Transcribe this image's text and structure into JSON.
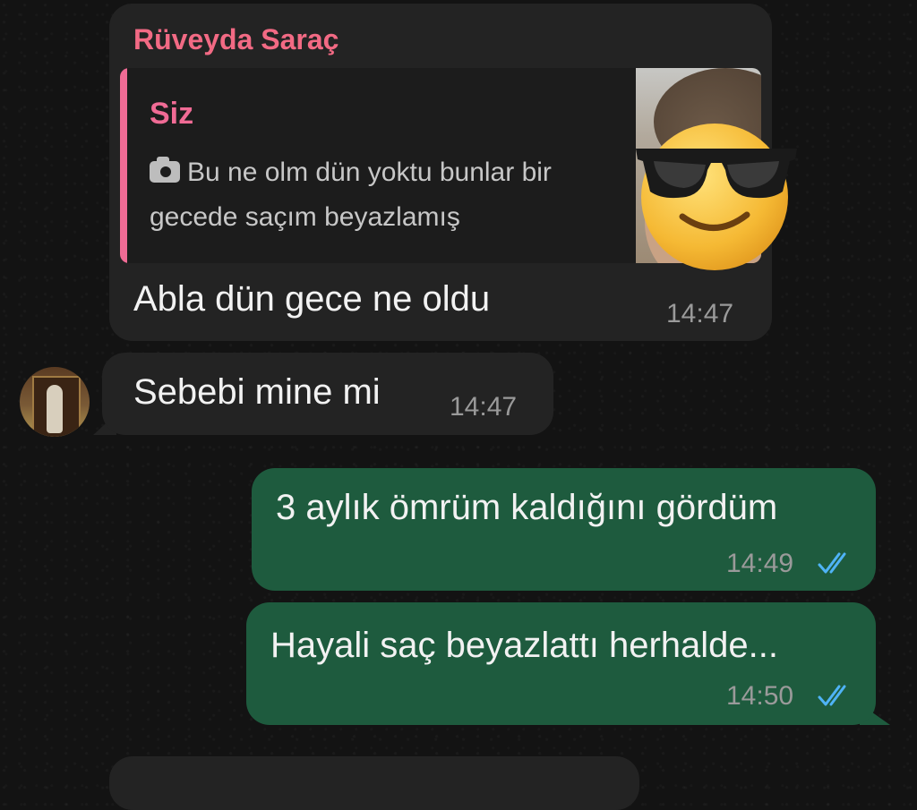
{
  "colors": {
    "background": "#131313",
    "incoming_bubble": "#232323",
    "outgoing_bubble": "#1e5b3e",
    "sender_name": "#f26a84",
    "quote_accent": "#f06b95",
    "read_ticks": "#4fb3f6",
    "timestamp": "#9a9a9a"
  },
  "messages": [
    {
      "sender": "Rüveyda Saraç",
      "reply": {
        "author": "Siz",
        "icon": "camera-icon",
        "text": "Bu ne olm dün yoktu bunlar bir gecede saçım beyazlamış",
        "thumbnail": "photo with sunglasses emoji sticker"
      },
      "text": "Abla dün gece ne oldu",
      "time": "14:47"
    },
    {
      "text": "Sebebi mine mi",
      "time": "14:47"
    },
    {
      "text": "3 aylık ömrüm kaldığını gördüm",
      "time": "14:49",
      "status_icon": "double-check-icon"
    },
    {
      "text": "Hayali saç beyazlattı herhalde...",
      "time": "14:50",
      "status_icon": "double-check-icon"
    }
  ]
}
